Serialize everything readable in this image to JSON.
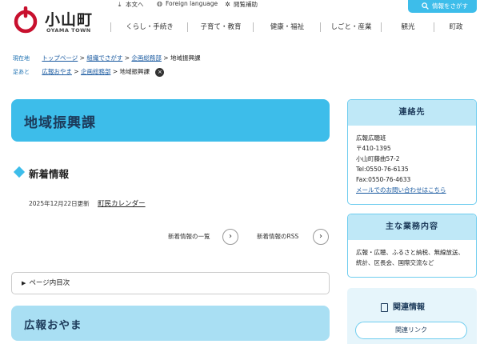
{
  "header": {
    "logo_name": "小山町",
    "logo_sub": "OYAMA TOWN",
    "util": [
      {
        "icon": "arrow-down-icon",
        "label": "本文へ"
      },
      {
        "icon": "globe-icon",
        "label": "Foreign language"
      },
      {
        "icon": "gear-icon",
        "label": "閲覧補助"
      }
    ],
    "search_label": "情報をさがす",
    "nav": [
      "くらし・手続き",
      "子育て・教育",
      "健康・福祉",
      "しごと・産業",
      "観光",
      "町政"
    ]
  },
  "breadcrumb": {
    "current_tag": "現在地",
    "current": [
      "トップページ",
      "組織でさがす",
      "企画総務部",
      "地域振興課"
    ],
    "history_tag": "足あと",
    "history": [
      "広報おやま",
      "企画総務部",
      "地域振興課"
    ],
    "separator": ">",
    "close_symbol": "×"
  },
  "main": {
    "page_title": "地域振興課",
    "news_title": "新着情報",
    "news_items": [
      {
        "date": "2025年12月22日更新",
        "link": "町民カレンダー"
      }
    ],
    "more_list": "新着情報の一覧",
    "more_rss": "新着情報のRSS",
    "toc_label": "ページ内目次",
    "section_title": "広報おやま"
  },
  "sidebar": {
    "contact_title": "連絡先",
    "contact_lines": [
      "広報広聴班",
      "〒410-1395",
      "小山町藤曲57-2",
      "Tel:0550-76-6135",
      "Fax:0550-76-4633"
    ],
    "contact_link": "メールでのお問い合わせはこちら",
    "duties_title": "主な業務内容",
    "duties_text": "広報・広聴、ふるさと納税、無線放送、統計、区長会、国際交流など",
    "related_title": "関連情報",
    "related_button": "関連リンク"
  },
  "colors": {
    "accent": "#3dbdea",
    "accent_light": "#a9dff3",
    "brand_red": "#c8102e",
    "title_text": "#1c3a5a"
  }
}
